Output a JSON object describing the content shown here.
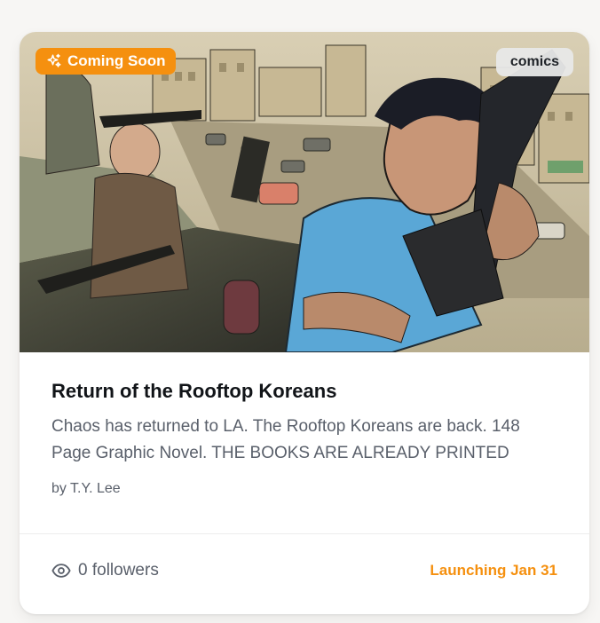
{
  "card": {
    "badge_status": "Coming Soon",
    "badge_status_icon": "sparkles-icon",
    "category": "comics",
    "title": "Return of the Rooftop Koreans",
    "description": "Chaos has returned to LA. The Rooftop Koreans are back. 148 Page Graphic Novel. THE BOOKS ARE ALREADY PRINTED",
    "author": "by T.Y. Lee",
    "followers": "0 followers",
    "followers_icon": "eye-icon",
    "launch": "Launching Jan 31",
    "colors": {
      "accent": "#f5900f",
      "text_dark": "#111418",
      "text_muted": "#5a606b"
    }
  }
}
